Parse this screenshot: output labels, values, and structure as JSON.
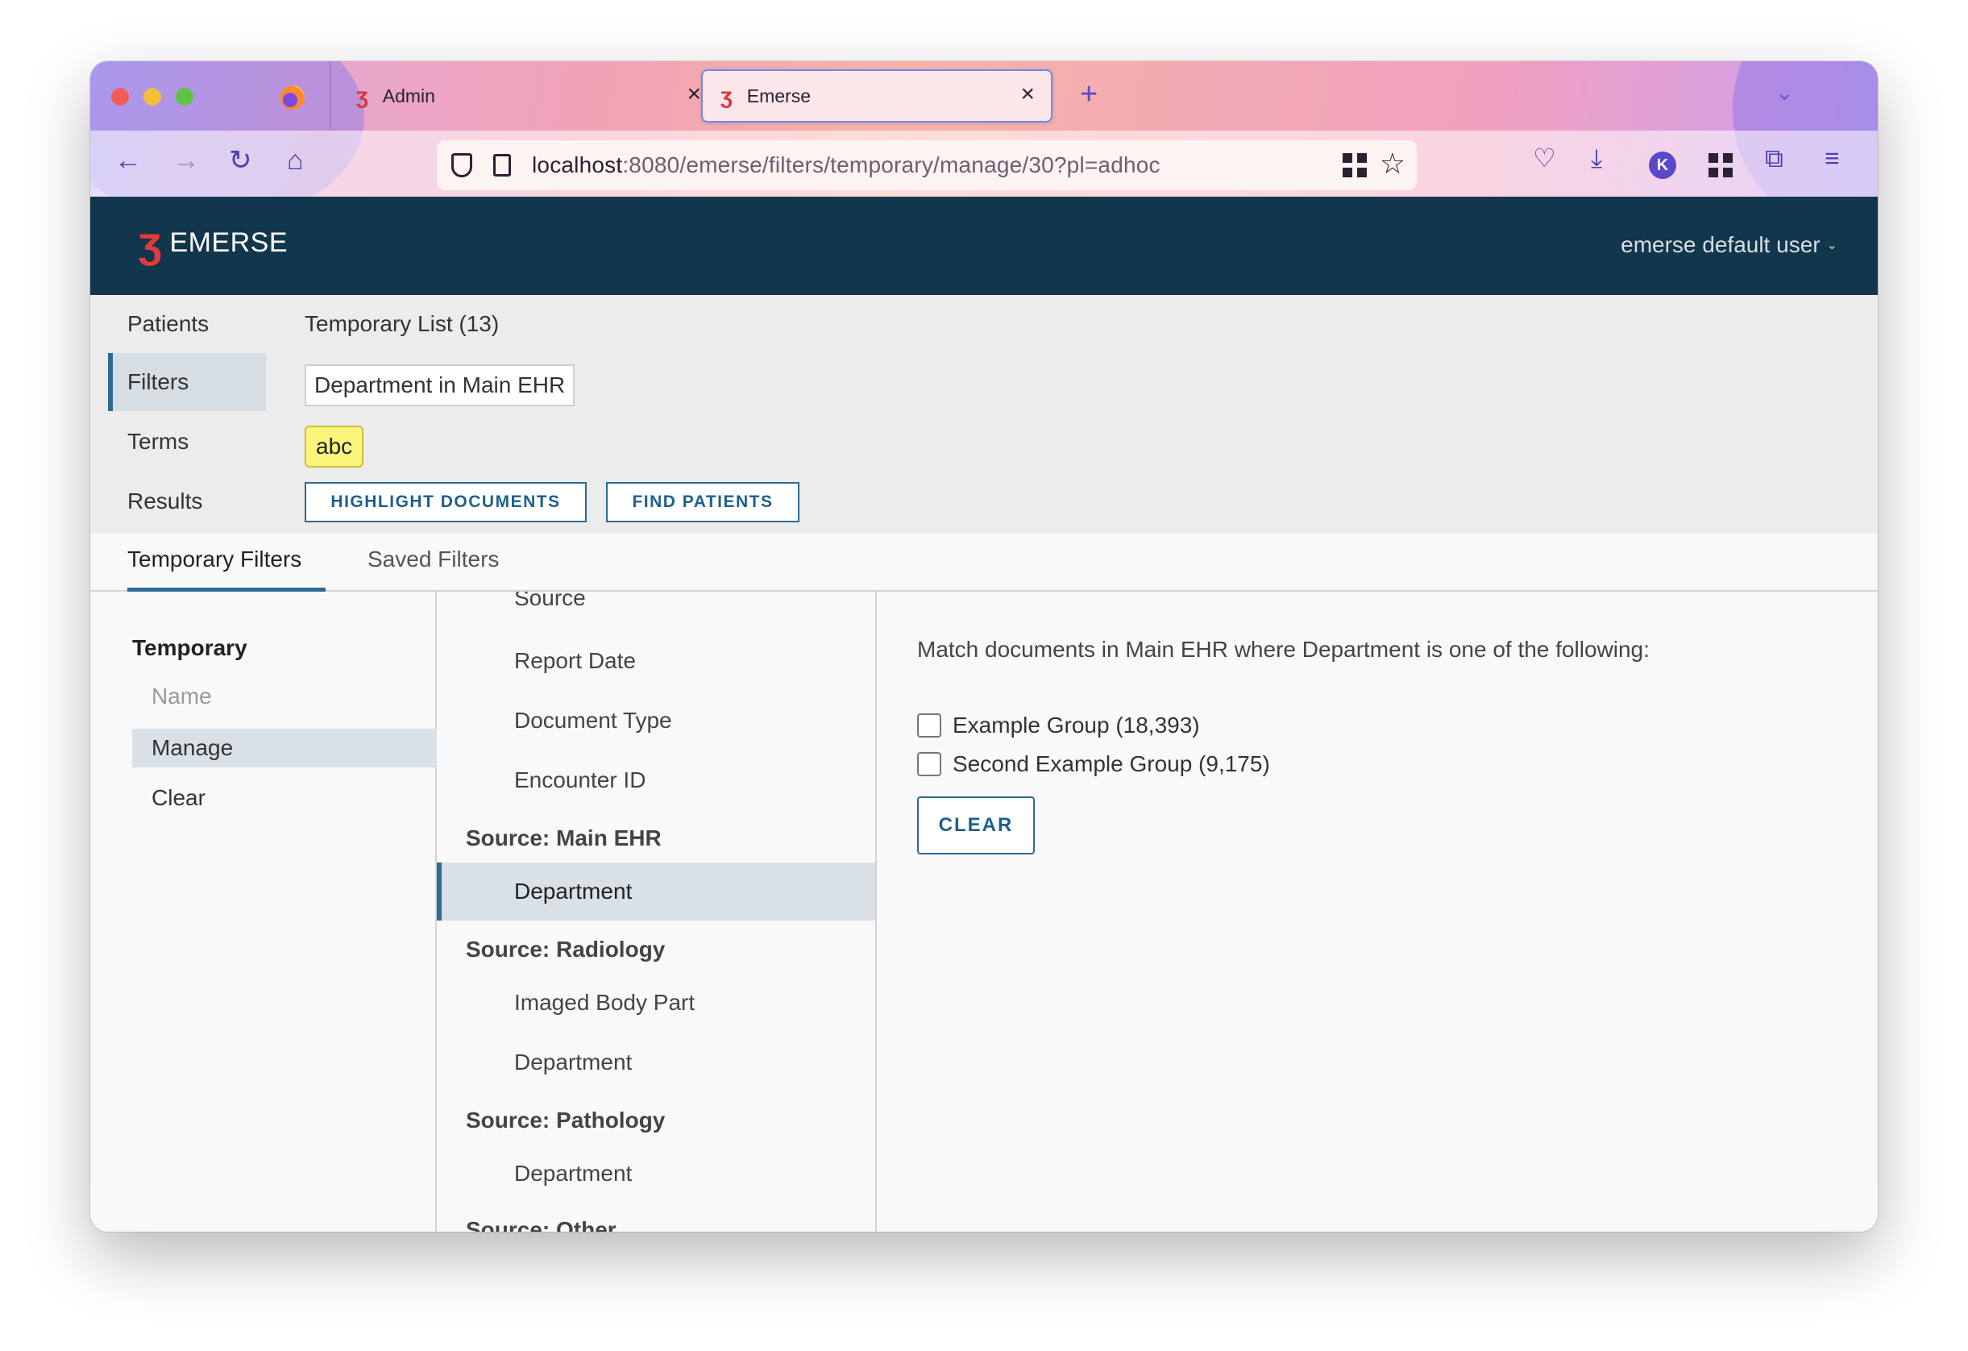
{
  "browser": {
    "tabs": [
      {
        "label": "Admin"
      },
      {
        "label": "Emerse"
      }
    ],
    "url_host": "localhost",
    "url_path": ":8080/emerse/filters/temporary/manage/30?pl=adhoc",
    "account_initial": "K"
  },
  "app": {
    "brand": "EMERSE",
    "user_menu": "emerse default user"
  },
  "summary": {
    "nav": [
      {
        "label": "Patients"
      },
      {
        "label": "Filters"
      },
      {
        "label": "Terms"
      },
      {
        "label": "Results"
      }
    ],
    "patients_value": "Temporary List (13)",
    "filter_pill": "Department in Main EHR",
    "term": "abc",
    "highlight_button": "HIGHLIGHT DOCUMENTS",
    "find_button": "FIND PATIENTS"
  },
  "filter_tabs": [
    {
      "label": "Temporary Filters"
    },
    {
      "label": "Saved Filters"
    }
  ],
  "left_menu": {
    "heading": "Temporary",
    "items": [
      {
        "label": "Name"
      },
      {
        "label": "Manage"
      },
      {
        "label": "Clear"
      }
    ]
  },
  "fields": {
    "top_items": [
      {
        "label": "Source"
      },
      {
        "label": "Report Date"
      },
      {
        "label": "Document Type"
      },
      {
        "label": "Encounter ID"
      }
    ],
    "main_ehr": {
      "heading": "Source: Main EHR",
      "items": [
        {
          "label": "Department"
        }
      ]
    },
    "radiology": {
      "heading": "Source: Radiology",
      "items": [
        {
          "label": "Imaged Body Part"
        },
        {
          "label": "Department"
        }
      ]
    },
    "pathology": {
      "heading": "Source: Pathology",
      "items": [
        {
          "label": "Department"
        }
      ]
    },
    "other": {
      "heading": "Source: Other"
    }
  },
  "detail": {
    "description": "Match documents in Main EHR where Department is one of the following:",
    "options": [
      {
        "label": "Example Group (18,393)",
        "checked": false
      },
      {
        "label": "Second Example Group (9,175)",
        "checked": false
      }
    ],
    "clear_button": "CLEAR"
  }
}
